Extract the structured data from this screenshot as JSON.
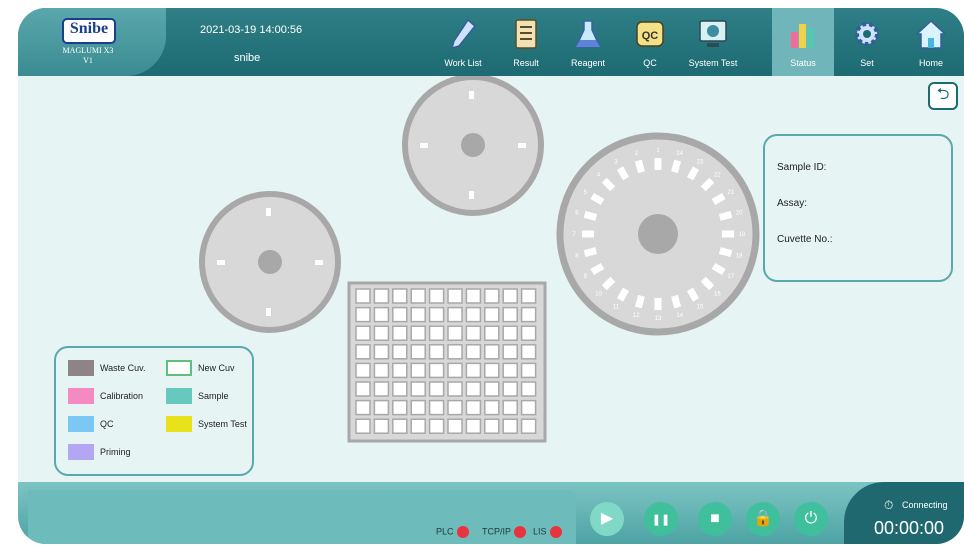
{
  "header": {
    "logo_text": "Snibe",
    "logo_sub": "Diagnostic",
    "model": "MAGLUMI X3",
    "version": "V1",
    "datetime": "2021-03-19 14:00:56",
    "user": "snibe"
  },
  "nav": [
    {
      "label": "Work List",
      "icon": "pencil-icon"
    },
    {
      "label": "Result",
      "icon": "document-icon"
    },
    {
      "label": "Reagent",
      "icon": "flask-icon"
    },
    {
      "label": "QC",
      "icon": "qc-icon"
    },
    {
      "label": "System Test",
      "icon": "monitor-icon"
    },
    {
      "label": "Status",
      "icon": "bar-chart-icon",
      "active": true
    },
    {
      "label": "Set",
      "icon": "gear-icon"
    },
    {
      "label": "Home",
      "icon": "home-icon"
    }
  ],
  "info_panel": {
    "sample_id_label": "Sample ID:",
    "assay_label": "Assay:",
    "cuvette_label": "Cuvette No.:"
  },
  "legend": [
    {
      "label": "Waste Cuv.",
      "color": "#8e8486"
    },
    {
      "label": "New Cuv",
      "color": "#ffffff",
      "outline": "#5ec07c"
    },
    {
      "label": "Calibration",
      "color": "#f48ac0"
    },
    {
      "label": "Sample",
      "color": "#67c9bd"
    },
    {
      "label": "QC",
      "color": "#7cc8f5"
    },
    {
      "label": "System Test",
      "color": "#e8e21c"
    },
    {
      "label": "Priming",
      "color": "#b3a6f2"
    }
  ],
  "small_disk_labels": [
    "1",
    "2",
    "3",
    "4"
  ],
  "large_disk_labels": [
    "1",
    "2",
    "3",
    "4",
    "5",
    "6",
    "7",
    "8",
    "9",
    "10",
    "11",
    "12",
    "13",
    "14",
    "15",
    "16",
    "17",
    "18",
    "19",
    "20",
    "21",
    "22",
    "23",
    "24"
  ],
  "cuvette_grid": {
    "rows": 8,
    "cols": 10
  },
  "status_indicators": [
    {
      "label": "PLC",
      "color": "#e8343f"
    },
    {
      "label": "TCP/IP",
      "color": "#e8343f"
    },
    {
      "label": "LIS",
      "color": "#e8343f"
    }
  ],
  "controls": [
    {
      "name": "play-icon",
      "glyph": "▶"
    },
    {
      "name": "pause-icon",
      "glyph": "❚❚"
    },
    {
      "name": "stop-icon",
      "glyph": "■"
    },
    {
      "name": "lock-icon",
      "glyph": "🔒"
    },
    {
      "name": "power-icon",
      "glyph": "⏻"
    }
  ],
  "connection": {
    "status": "Connecting",
    "timer": "00:00:00"
  }
}
